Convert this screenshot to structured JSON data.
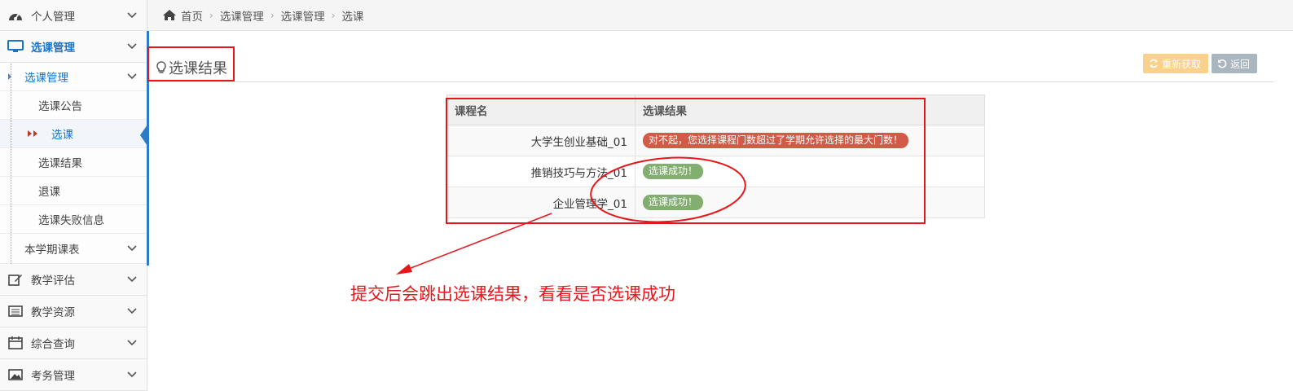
{
  "sidebar": {
    "items": [
      {
        "label": "个人管理",
        "icon": "dashboard-icon"
      },
      {
        "label": "选课管理",
        "icon": "monitor-icon",
        "active": true
      },
      {
        "label": "教学评估",
        "icon": "edit-icon"
      },
      {
        "label": "教学资源",
        "icon": "list-icon"
      },
      {
        "label": "综合查询",
        "icon": "calendar-icon"
      },
      {
        "label": "考务管理",
        "icon": "image-icon"
      }
    ],
    "submenu": {
      "group_label": "选课管理",
      "children": [
        "选课公告",
        "选课",
        "选课结果",
        "退课",
        "选课失败信息"
      ],
      "current": "选课",
      "next_group_label": "本学期课表"
    }
  },
  "breadcrumb": [
    "首页",
    "选课管理",
    "选课管理",
    "选课"
  ],
  "page": {
    "title": "选课结果",
    "buttons": {
      "refresh": "重新获取",
      "back": "返回"
    }
  },
  "table": {
    "headers": [
      "课程名",
      "选课结果"
    ],
    "rows": [
      {
        "course": "大学生创业基础_01",
        "result": "对不起，您选择课程门数超过了学期允许选择的最大门数！",
        "status": "fail"
      },
      {
        "course": "推销技巧与方法_01",
        "result": "选课成功！",
        "status": "success"
      },
      {
        "course": "企业管理学_01",
        "result": "选课成功！",
        "status": "success"
      }
    ]
  },
  "annotation": {
    "text": "提交后会跳出选课结果，看看是否选课成功",
    "color": "#e8161b"
  },
  "colors": {
    "accent": "#1874c9",
    "fail": "#d15b47",
    "success": "#82af6f",
    "warning": "#f9d08c"
  }
}
